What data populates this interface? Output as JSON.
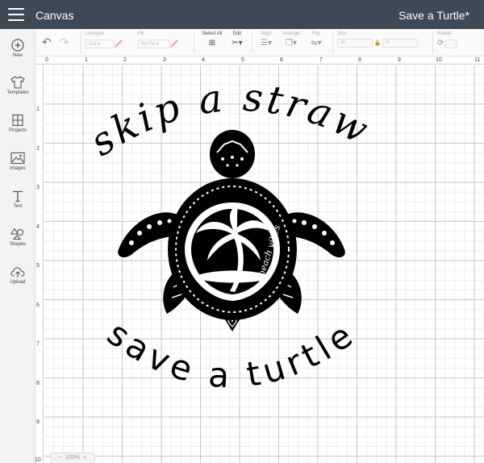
{
  "header": {
    "app_title": "Canvas",
    "project_title": "Save a Turtle*"
  },
  "toolbar": {
    "linetype": {
      "label": "Linetype",
      "value": "Cut"
    },
    "fill": {
      "label": "Fill",
      "value": "No Fill"
    },
    "select_all": {
      "label": "Select All"
    },
    "edit": {
      "label": "Edit"
    },
    "align": {
      "label": "Align"
    },
    "arrange": {
      "label": "Arrange"
    },
    "flip": {
      "label": "Flip"
    },
    "size": {
      "label": "Size",
      "w": "W",
      "h": "H"
    },
    "rotate": {
      "label": "Rotate"
    }
  },
  "sidebar": {
    "items": [
      {
        "label": "New",
        "icon": "plus-circle-icon"
      },
      {
        "label": "Templates",
        "icon": "tshirt-icon"
      },
      {
        "label": "Projects",
        "icon": "projects-icon"
      },
      {
        "label": "Images",
        "icon": "image-icon"
      },
      {
        "label": "Text",
        "icon": "text-icon"
      },
      {
        "label": "Shapes",
        "icon": "shapes-icon"
      },
      {
        "label": "Upload",
        "icon": "cloud-upload-icon"
      }
    ]
  },
  "rulers": {
    "top": [
      "0",
      "1",
      "2",
      "3",
      "4",
      "5",
      "6",
      "7",
      "8",
      "9",
      "10",
      "11"
    ],
    "left": [
      "1",
      "2",
      "3",
      "4",
      "5",
      "6",
      "7",
      "8",
      "9",
      "10"
    ]
  },
  "design": {
    "top_text": "skip a straw",
    "bottom_text": "save a turtle",
    "shell_text": "beach vibes"
  },
  "zoom": {
    "value": "100%",
    "minus": "−",
    "plus": "+"
  },
  "colors": {
    "header_bg": "#3c4a55",
    "sidebar_bg": "#f2f3f4",
    "accent_pen": "#e6a0b4",
    "design": "#000000"
  }
}
